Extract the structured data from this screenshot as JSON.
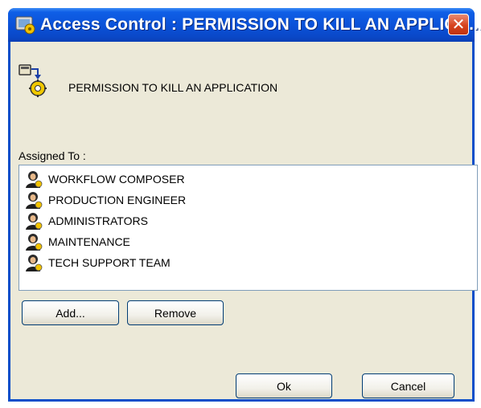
{
  "window": {
    "title": "Access Control : PERMISSION TO KILL AN APPLICA...",
    "close_label": "✕"
  },
  "permission": {
    "name": "PERMISSION TO KILL AN APPLICATION",
    "icon": "permission-gear-icon"
  },
  "assigned": {
    "label": "Assigned To :",
    "items": [
      {
        "label": "WORKFLOW COMPOSER",
        "icon": "user-group-icon"
      },
      {
        "label": "PRODUCTION ENGINEER",
        "icon": "user-group-icon"
      },
      {
        "label": "ADMINISTRATORS",
        "icon": "user-group-icon"
      },
      {
        "label": "MAINTENANCE",
        "icon": "user-group-icon"
      },
      {
        "label": "TECH SUPPORT TEAM",
        "icon": "user-group-icon"
      }
    ]
  },
  "buttons": {
    "add": "Add...",
    "remove": "Remove",
    "ok": "Ok",
    "cancel": "Cancel"
  },
  "colors": {
    "titlebar": "#0b52d9",
    "dialog_background": "#ece9d8",
    "close_button": "#d7421d"
  }
}
